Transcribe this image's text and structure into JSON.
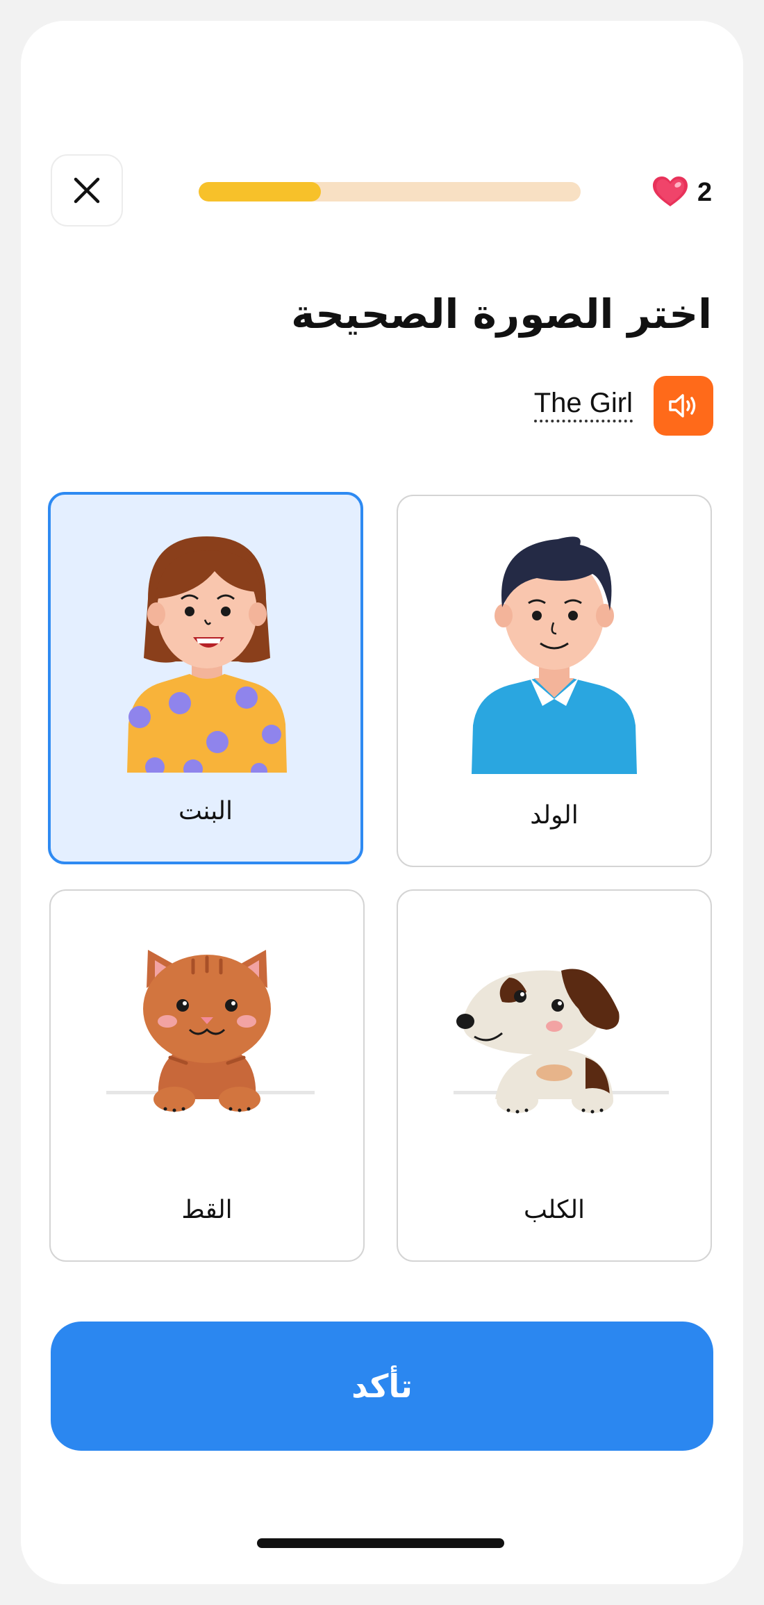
{
  "header": {
    "close_icon": "close-icon",
    "progress_fraction": 0.32,
    "hearts": {
      "icon": "heart-icon",
      "count": "2"
    }
  },
  "prompt": {
    "title": "اختر الصورة الصحيحة",
    "word": "The Girl",
    "speaker_icon": "speaker-icon"
  },
  "options": [
    {
      "id": "girl",
      "label": "البنت",
      "selected": true
    },
    {
      "id": "boy",
      "label": "الولد",
      "selected": false
    },
    {
      "id": "cat",
      "label": "القط",
      "selected": false
    },
    {
      "id": "dog",
      "label": "الكلب",
      "selected": false
    }
  ],
  "footer": {
    "confirm_label": "تأكد"
  },
  "colors": {
    "progress_fill": "#f7c12a",
    "progress_track": "#f8e0c3",
    "speaker_bg": "#ff6a1a",
    "primary": "#2b87f0",
    "selected_bg": "#e4efff",
    "selected_border": "#2e8af2"
  }
}
